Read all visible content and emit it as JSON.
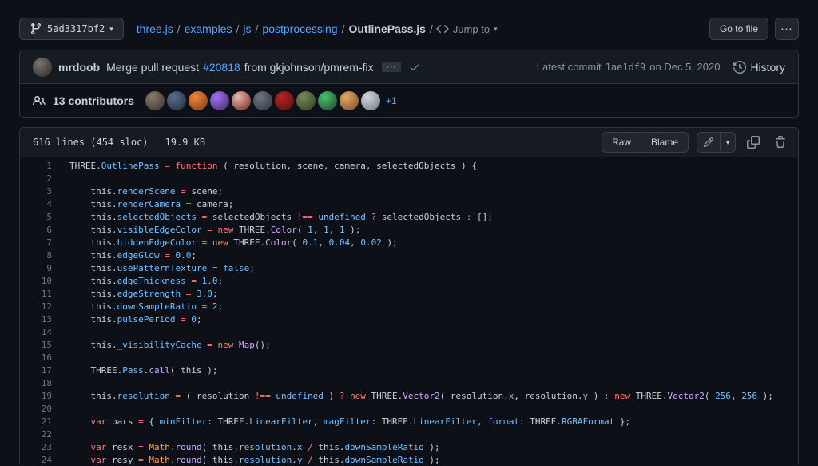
{
  "colors": {
    "page_bg": "#0d1117",
    "panel_bg": "#161b22",
    "border": "#30363d",
    "text": "#c9d1d9",
    "muted": "#8b949e",
    "link_blue": "#58a6ff",
    "success_green": "#3fb950",
    "syntax_keyword_red": "#ff7b72",
    "syntax_constant_blue": "#79c0ff",
    "syntax_entity_purple": "#d2a8ff",
    "syntax_builtin_orange": "#ffa657",
    "line_number": "#6e7681"
  },
  "icons": {
    "kebab": "⋯",
    "caret_down": "▾"
  },
  "top_bar": {
    "branch_button_label": "5ad3317bf2",
    "breadcrumb": [
      {
        "label": "three.js",
        "type": "link"
      },
      {
        "label": "examples",
        "type": "link"
      },
      {
        "label": "js",
        "type": "link"
      },
      {
        "label": "postprocessing",
        "type": "link"
      },
      {
        "label": "OutlinePass.js",
        "type": "current"
      }
    ],
    "jump_to_label": "Jump to",
    "go_to_file_label": "Go to file"
  },
  "commit_bar": {
    "author": "mrdoob",
    "author_avatar": {
      "light": "#7a746e",
      "dark": "#2a2724"
    },
    "message_prefix": "Merge pull request",
    "pr_number": "#20818",
    "message_suffix": "from gkjohnson/pmrem-fix",
    "latest_commit_label": "Latest commit",
    "commit_sha": "1ae1df9",
    "commit_date": "on Dec 5, 2020",
    "history_label": "History"
  },
  "contributors": {
    "count_label": "13 contributors",
    "overflow": "+1",
    "avatars": [
      {
        "light": "#8a7a6a",
        "dark": "#3a322b"
      },
      {
        "light": "#5a6e8c",
        "dark": "#1f2a3a"
      },
      {
        "light": "#f0883e",
        "dark": "#7a3a10"
      },
      {
        "light": "#a371f7",
        "dark": "#3d2a5c"
      },
      {
        "light": "#e8b9a8",
        "dark": "#6e241c"
      },
      {
        "light": "#6e7681",
        "dark": "#2d333b"
      },
      {
        "light": "#b62324",
        "dark": "#4e1210"
      },
      {
        "light": "#768a5a",
        "dark": "#2f3a22"
      },
      {
        "light": "#4ac26b",
        "dark": "#1b4332"
      },
      {
        "light": "#e3a869",
        "dark": "#7a4a22"
      },
      {
        "light": "#d0d7de",
        "dark": "#6e7681"
      }
    ]
  },
  "file_header": {
    "lines_info": "616 lines (454 sloc)",
    "size_info": "19.9 KB",
    "raw_label": "Raw",
    "blame_label": "Blame"
  },
  "code": {
    "lines": [
      {
        "n": 1,
        "t": [
          [
            "THREE.",
            "pl"
          ],
          [
            "OutlinePass",
            "c"
          ],
          [
            " ",
            "pl"
          ],
          [
            "=",
            "k"
          ],
          [
            " ",
            "pl"
          ],
          [
            "function",
            "k"
          ],
          [
            " ( resolution, scene, camera, selectedObjects ) {",
            "pl"
          ]
        ]
      },
      {
        "n": 2,
        "t": []
      },
      {
        "n": 3,
        "t": [
          [
            "\tthis.",
            "pl"
          ],
          [
            "renderScene",
            "c"
          ],
          [
            " ",
            "pl"
          ],
          [
            "=",
            "k"
          ],
          [
            " scene;",
            "pl"
          ]
        ]
      },
      {
        "n": 4,
        "t": [
          [
            "\tthis.",
            "pl"
          ],
          [
            "renderCamera",
            "c"
          ],
          [
            " ",
            "pl"
          ],
          [
            "=",
            "k"
          ],
          [
            " camera;",
            "pl"
          ]
        ]
      },
      {
        "n": 5,
        "t": [
          [
            "\tthis.",
            "pl"
          ],
          [
            "selectedObjects",
            "c"
          ],
          [
            " ",
            "pl"
          ],
          [
            "=",
            "k"
          ],
          [
            " selectedObjects ",
            "pl"
          ],
          [
            "!==",
            "k"
          ],
          [
            " ",
            "pl"
          ],
          [
            "undefined",
            "c"
          ],
          [
            " ",
            "pl"
          ],
          [
            "?",
            "k"
          ],
          [
            " selectedObjects ",
            "pl"
          ],
          [
            ":",
            "k"
          ],
          [
            " [];",
            "pl"
          ]
        ]
      },
      {
        "n": 6,
        "t": [
          [
            "\tthis.",
            "pl"
          ],
          [
            "visibleEdgeColor",
            "c"
          ],
          [
            " ",
            "pl"
          ],
          [
            "=",
            "k"
          ],
          [
            " ",
            "pl"
          ],
          [
            "new",
            "k"
          ],
          [
            " THREE.",
            "pl"
          ],
          [
            "Color",
            "e"
          ],
          [
            "( ",
            "pl"
          ],
          [
            "1",
            "c"
          ],
          [
            ", ",
            "pl"
          ],
          [
            "1",
            "c"
          ],
          [
            ", ",
            "pl"
          ],
          [
            "1",
            "c"
          ],
          [
            " );",
            "pl"
          ]
        ]
      },
      {
        "n": 7,
        "t": [
          [
            "\tthis.",
            "pl"
          ],
          [
            "hiddenEdgeColor",
            "c"
          ],
          [
            " ",
            "pl"
          ],
          [
            "=",
            "k"
          ],
          [
            " ",
            "pl"
          ],
          [
            "new",
            "k"
          ],
          [
            " THREE.",
            "pl"
          ],
          [
            "Color",
            "e"
          ],
          [
            "( ",
            "pl"
          ],
          [
            "0.1",
            "c"
          ],
          [
            ", ",
            "pl"
          ],
          [
            "0.04",
            "c"
          ],
          [
            ", ",
            "pl"
          ],
          [
            "0.02",
            "c"
          ],
          [
            " );",
            "pl"
          ]
        ]
      },
      {
        "n": 8,
        "t": [
          [
            "\tthis.",
            "pl"
          ],
          [
            "edgeGlow",
            "c"
          ],
          [
            " ",
            "pl"
          ],
          [
            "=",
            "k"
          ],
          [
            " ",
            "pl"
          ],
          [
            "0.0",
            "c"
          ],
          [
            ";",
            "pl"
          ]
        ]
      },
      {
        "n": 9,
        "t": [
          [
            "\tthis.",
            "pl"
          ],
          [
            "usePatternTexture",
            "c"
          ],
          [
            " ",
            "pl"
          ],
          [
            "=",
            "k"
          ],
          [
            " ",
            "pl"
          ],
          [
            "false",
            "c"
          ],
          [
            ";",
            "pl"
          ]
        ]
      },
      {
        "n": 10,
        "t": [
          [
            "\tthis.",
            "pl"
          ],
          [
            "edgeThickness",
            "c"
          ],
          [
            " ",
            "pl"
          ],
          [
            "=",
            "k"
          ],
          [
            " ",
            "pl"
          ],
          [
            "1.0",
            "c"
          ],
          [
            ";",
            "pl"
          ]
        ]
      },
      {
        "n": 11,
        "t": [
          [
            "\tthis.",
            "pl"
          ],
          [
            "edgeStrength",
            "c"
          ],
          [
            " ",
            "pl"
          ],
          [
            "=",
            "k"
          ],
          [
            " ",
            "pl"
          ],
          [
            "3.0",
            "c"
          ],
          [
            ";",
            "pl"
          ]
        ]
      },
      {
        "n": 12,
        "t": [
          [
            "\tthis.",
            "pl"
          ],
          [
            "downSampleRatio",
            "c"
          ],
          [
            " ",
            "pl"
          ],
          [
            "=",
            "k"
          ],
          [
            " ",
            "pl"
          ],
          [
            "2",
            "c"
          ],
          [
            ";",
            "pl"
          ]
        ]
      },
      {
        "n": 13,
        "t": [
          [
            "\tthis.",
            "pl"
          ],
          [
            "pulsePeriod",
            "c"
          ],
          [
            " ",
            "pl"
          ],
          [
            "=",
            "k"
          ],
          [
            " ",
            "pl"
          ],
          [
            "0",
            "c"
          ],
          [
            ";",
            "pl"
          ]
        ]
      },
      {
        "n": 14,
        "t": []
      },
      {
        "n": 15,
        "t": [
          [
            "\tthis.",
            "pl"
          ],
          [
            "_visibilityCache",
            "c"
          ],
          [
            " ",
            "pl"
          ],
          [
            "=",
            "k"
          ],
          [
            " ",
            "pl"
          ],
          [
            "new",
            "k"
          ],
          [
            " ",
            "pl"
          ],
          [
            "Map",
            "e"
          ],
          [
            "();",
            "pl"
          ]
        ]
      },
      {
        "n": 16,
        "t": []
      },
      {
        "n": 17,
        "t": [
          [
            "\tTHREE.",
            "pl"
          ],
          [
            "Pass",
            "c"
          ],
          [
            ".",
            "pl"
          ],
          [
            "call",
            "e"
          ],
          [
            "( this );",
            "pl"
          ]
        ]
      },
      {
        "n": 18,
        "t": []
      },
      {
        "n": 19,
        "t": [
          [
            "\tthis.",
            "pl"
          ],
          [
            "resolution",
            "c"
          ],
          [
            " ",
            "pl"
          ],
          [
            "=",
            "k"
          ],
          [
            " ( resolution ",
            "pl"
          ],
          [
            "!==",
            "k"
          ],
          [
            " ",
            "pl"
          ],
          [
            "undefined",
            "c"
          ],
          [
            " ) ",
            "pl"
          ],
          [
            "?",
            "k"
          ],
          [
            " ",
            "pl"
          ],
          [
            "new",
            "k"
          ],
          [
            " THREE.",
            "pl"
          ],
          [
            "Vector2",
            "e"
          ],
          [
            "( resolution.",
            "pl"
          ],
          [
            "x",
            "c"
          ],
          [
            ", resolution.",
            "pl"
          ],
          [
            "y",
            "c"
          ],
          [
            " ) ",
            "pl"
          ],
          [
            ":",
            "k"
          ],
          [
            " ",
            "pl"
          ],
          [
            "new",
            "k"
          ],
          [
            " THREE.",
            "pl"
          ],
          [
            "Vector2",
            "e"
          ],
          [
            "( ",
            "pl"
          ],
          [
            "256",
            "c"
          ],
          [
            ", ",
            "pl"
          ],
          [
            "256",
            "c"
          ],
          [
            " );",
            "pl"
          ]
        ]
      },
      {
        "n": 20,
        "t": []
      },
      {
        "n": 21,
        "t": [
          [
            "\t",
            "pl"
          ],
          [
            "var",
            "k"
          ],
          [
            " pars ",
            "pl"
          ],
          [
            "=",
            "k"
          ],
          [
            " { ",
            "pl"
          ],
          [
            "minFilter",
            "c"
          ],
          [
            ": THREE.",
            "pl"
          ],
          [
            "LinearFilter",
            "c"
          ],
          [
            ", ",
            "pl"
          ],
          [
            "magFilter",
            "c"
          ],
          [
            ": THREE.",
            "pl"
          ],
          [
            "LinearFilter",
            "c"
          ],
          [
            ", ",
            "pl"
          ],
          [
            "format",
            "c"
          ],
          [
            ": THREE.",
            "pl"
          ],
          [
            "RGBAFormat",
            "c"
          ],
          [
            " };",
            "pl"
          ]
        ]
      },
      {
        "n": 22,
        "t": []
      },
      {
        "n": 23,
        "t": [
          [
            "\t",
            "pl"
          ],
          [
            "var",
            "k"
          ],
          [
            " resx ",
            "pl"
          ],
          [
            "=",
            "k"
          ],
          [
            " ",
            "pl"
          ],
          [
            "Math",
            "o"
          ],
          [
            ".",
            "pl"
          ],
          [
            "round",
            "e"
          ],
          [
            "( this.",
            "pl"
          ],
          [
            "resolution",
            "c"
          ],
          [
            ".",
            "pl"
          ],
          [
            "x",
            "c"
          ],
          [
            " ",
            "pl"
          ],
          [
            "/",
            "k"
          ],
          [
            " this.",
            "pl"
          ],
          [
            "downSampleRatio",
            "c"
          ],
          [
            " );",
            "pl"
          ]
        ]
      },
      {
        "n": 24,
        "t": [
          [
            "\t",
            "pl"
          ],
          [
            "var",
            "k"
          ],
          [
            " resy ",
            "pl"
          ],
          [
            "=",
            "k"
          ],
          [
            " ",
            "pl"
          ],
          [
            "Math",
            "o"
          ],
          [
            ".",
            "pl"
          ],
          [
            "round",
            "e"
          ],
          [
            "( this.",
            "pl"
          ],
          [
            "resolution",
            "c"
          ],
          [
            ".",
            "pl"
          ],
          [
            "y",
            "c"
          ],
          [
            " ",
            "pl"
          ],
          [
            "/",
            "k"
          ],
          [
            " this.",
            "pl"
          ],
          [
            "downSampleRatio",
            "c"
          ],
          [
            " );",
            "pl"
          ]
        ]
      }
    ]
  }
}
